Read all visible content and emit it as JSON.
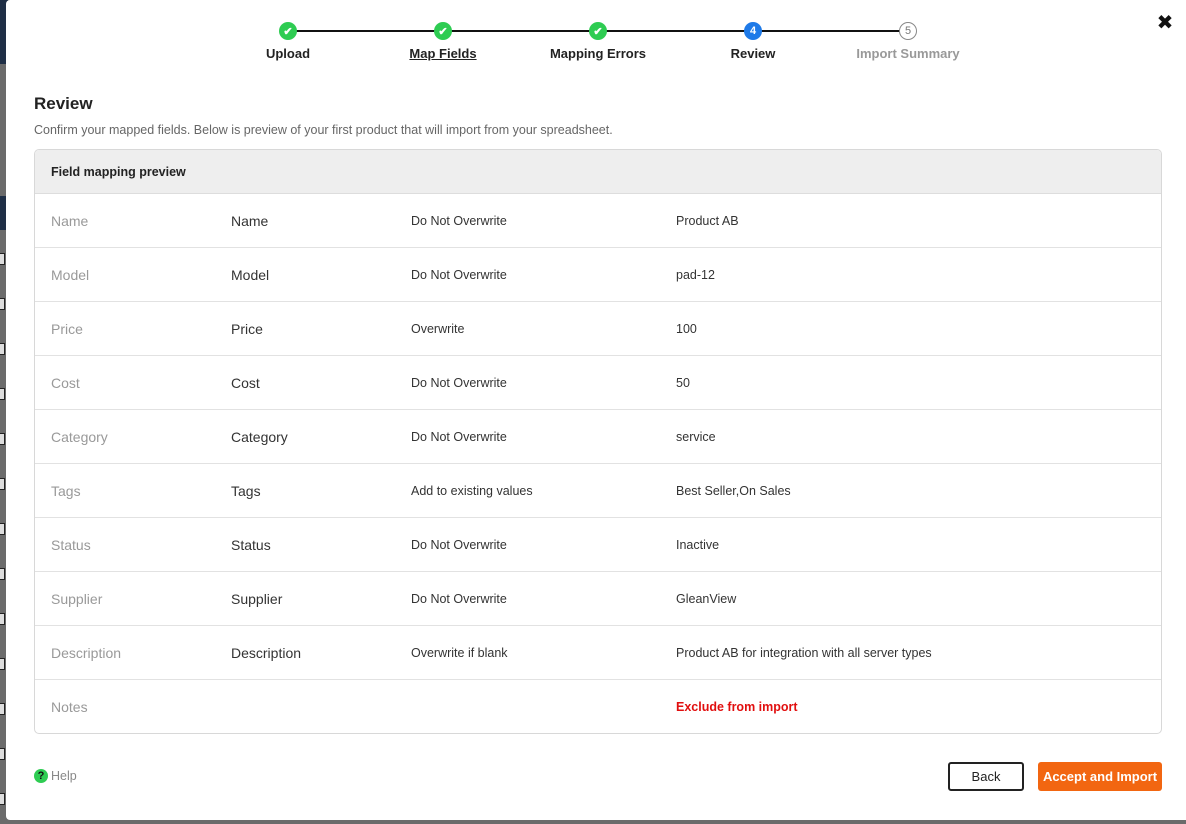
{
  "stepper": {
    "steps": [
      {
        "label": "Upload",
        "state": "done",
        "number": "1"
      },
      {
        "label": "Map Fields",
        "state": "done",
        "number": "2"
      },
      {
        "label": "Mapping Errors",
        "state": "done",
        "number": "3"
      },
      {
        "label": "Review",
        "state": "current",
        "number": "4"
      },
      {
        "label": "Import Summary",
        "state": "future",
        "number": "5"
      }
    ],
    "check_glyph": "✔"
  },
  "close_glyph": "✖",
  "page": {
    "title": "Review",
    "subtitle": "Confirm your mapped fields. Below is preview of your first product that will import from your spreadsheet."
  },
  "table": {
    "heading": "Field mapping preview",
    "rows": [
      {
        "source": "Name",
        "target": "Name",
        "mode": "Do Not Overwrite",
        "value": "Product AB"
      },
      {
        "source": "Model",
        "target": "Model",
        "mode": "Do Not Overwrite",
        "value": "pad-12"
      },
      {
        "source": "Price",
        "target": "Price",
        "mode": "Overwrite",
        "value": "100"
      },
      {
        "source": "Cost",
        "target": "Cost",
        "mode": "Do Not Overwrite",
        "value": "50"
      },
      {
        "source": "Category",
        "target": "Category",
        "mode": "Do Not Overwrite",
        "value": "service"
      },
      {
        "source": "Tags",
        "target": "Tags",
        "mode": "Add to existing values",
        "value": "Best Seller,On Sales"
      },
      {
        "source": "Status",
        "target": "Status",
        "mode": "Do Not Overwrite",
        "value": "Inactive"
      },
      {
        "source": "Supplier",
        "target": "Supplier",
        "mode": "Do Not Overwrite",
        "value": "GleanView"
      },
      {
        "source": "Description",
        "target": "Description",
        "mode": "Overwrite if blank",
        "value": "Product AB for integration with all server types"
      },
      {
        "source": "Notes",
        "target": "",
        "mode": "",
        "value": "Exclude from import"
      }
    ]
  },
  "footer": {
    "help_label": "Help",
    "help_glyph": "?",
    "back_label": "Back",
    "accept_label": "Accept and Import"
  },
  "colors": {
    "done": "#2ecc52",
    "current": "#1e7ae8",
    "accent": "#f26611",
    "exclude": "#e10f0f"
  }
}
